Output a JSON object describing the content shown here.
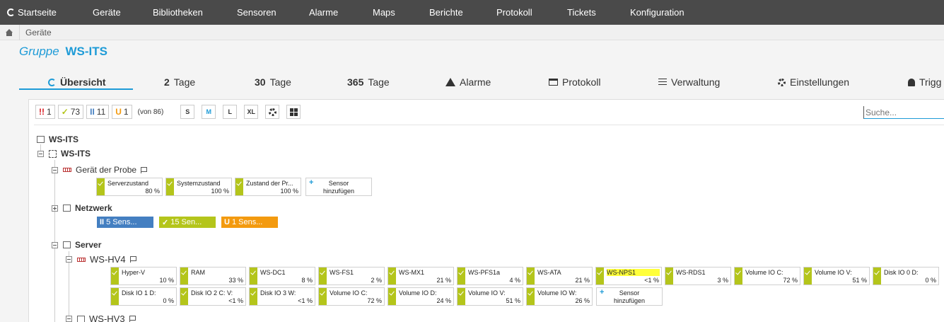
{
  "nav": {
    "items": [
      "Startseite",
      "Geräte",
      "Bibliotheken",
      "Sensoren",
      "Alarme",
      "Maps",
      "Berichte",
      "Protokoll",
      "Tickets",
      "Konfiguration"
    ]
  },
  "breadcrumb": {
    "current": "Geräte"
  },
  "group": {
    "label": "Gruppe",
    "name": "WS-ITS"
  },
  "tabs": {
    "overview": "Übersicht",
    "t2_num": "2",
    "t2_label": "Tage",
    "t30_num": "30",
    "t30_label": "Tage",
    "t365_num": "365",
    "t365_label": "Tage",
    "alarms": "Alarme",
    "log": "Protokoll",
    "manage": "Verwaltung",
    "settings": "Einstellungen",
    "triggers": "Trigg"
  },
  "toolbar": {
    "down": "1",
    "down_sym": "!!",
    "up": "73",
    "up_sym": "✓",
    "paused": "11",
    "paused_sym": "II",
    "unusual": "1",
    "unusual_sym": "U",
    "of_total": "(von 86)",
    "sizes": [
      "S",
      "M",
      "L",
      "XL"
    ],
    "search_placeholder": "Suche..."
  },
  "tree": {
    "root": "WS-ITS",
    "probe": "WS-ITS",
    "probe_device": "Gerät der Probe",
    "network": "Netzwerk",
    "server": "Server",
    "hv4": "WS-HV4",
    "hv3": "WS-HV3"
  },
  "probe_sensors": [
    {
      "name": "Serverzustand",
      "value": "80 %"
    },
    {
      "name": "Systemzustand",
      "value": "100 %"
    },
    {
      "name": "Zustand der Pr...",
      "value": "100 %"
    }
  ],
  "add_sensor": {
    "line1": "Sensor",
    "line2": "hinzufügen"
  },
  "network_summary": {
    "paused": "5 Sens...",
    "paused_sym": "II",
    "up": "15 Sen...",
    "up_sym": "✓",
    "unusual": "1 Sens...",
    "unusual_sym": "U"
  },
  "hv4_sensors_row1": [
    {
      "name": "Hyper-V",
      "value": "10 %"
    },
    {
      "name": "RAM",
      "value": "33 %"
    },
    {
      "name": "WS-DC1",
      "value": "8 %"
    },
    {
      "name": "WS-FS1",
      "value": "2 %"
    },
    {
      "name": "WS-MX1",
      "value": "21 %"
    },
    {
      "name": "WS-PFS1a",
      "value": "4 %"
    },
    {
      "name": "WS-ATA",
      "value": "21 %"
    },
    {
      "name": "WS-NPS1",
      "value": "<1 %"
    },
    {
      "name": "WS-RDS1",
      "value": "3 %"
    },
    {
      "name": "Volume IO C:",
      "value": "72 %"
    },
    {
      "name": "Volume IO V:",
      "value": "51 %"
    },
    {
      "name": "Disk IO 0 D:",
      "value": "0 %"
    }
  ],
  "hv4_sensors_row2": [
    {
      "name": "Disk IO 1 D:",
      "value": "0 %"
    },
    {
      "name": "Disk IO 2 C: V:",
      "value": "<1 %"
    },
    {
      "name": "Disk IO 3 W:",
      "value": "<1 %"
    },
    {
      "name": "Volume IO C:",
      "value": "72 %"
    },
    {
      "name": "Volume IO D:",
      "value": "24 %"
    },
    {
      "name": "Volume IO V:",
      "value": "51 %"
    },
    {
      "name": "Volume IO W:",
      "value": "26 %"
    }
  ],
  "colors": {
    "accent": "#1e9bd7",
    "up": "#b4c51b",
    "paused": "#447fc1",
    "unusual": "#f39a0f",
    "down": "#d71920",
    "highlight": "#ffff3a"
  }
}
